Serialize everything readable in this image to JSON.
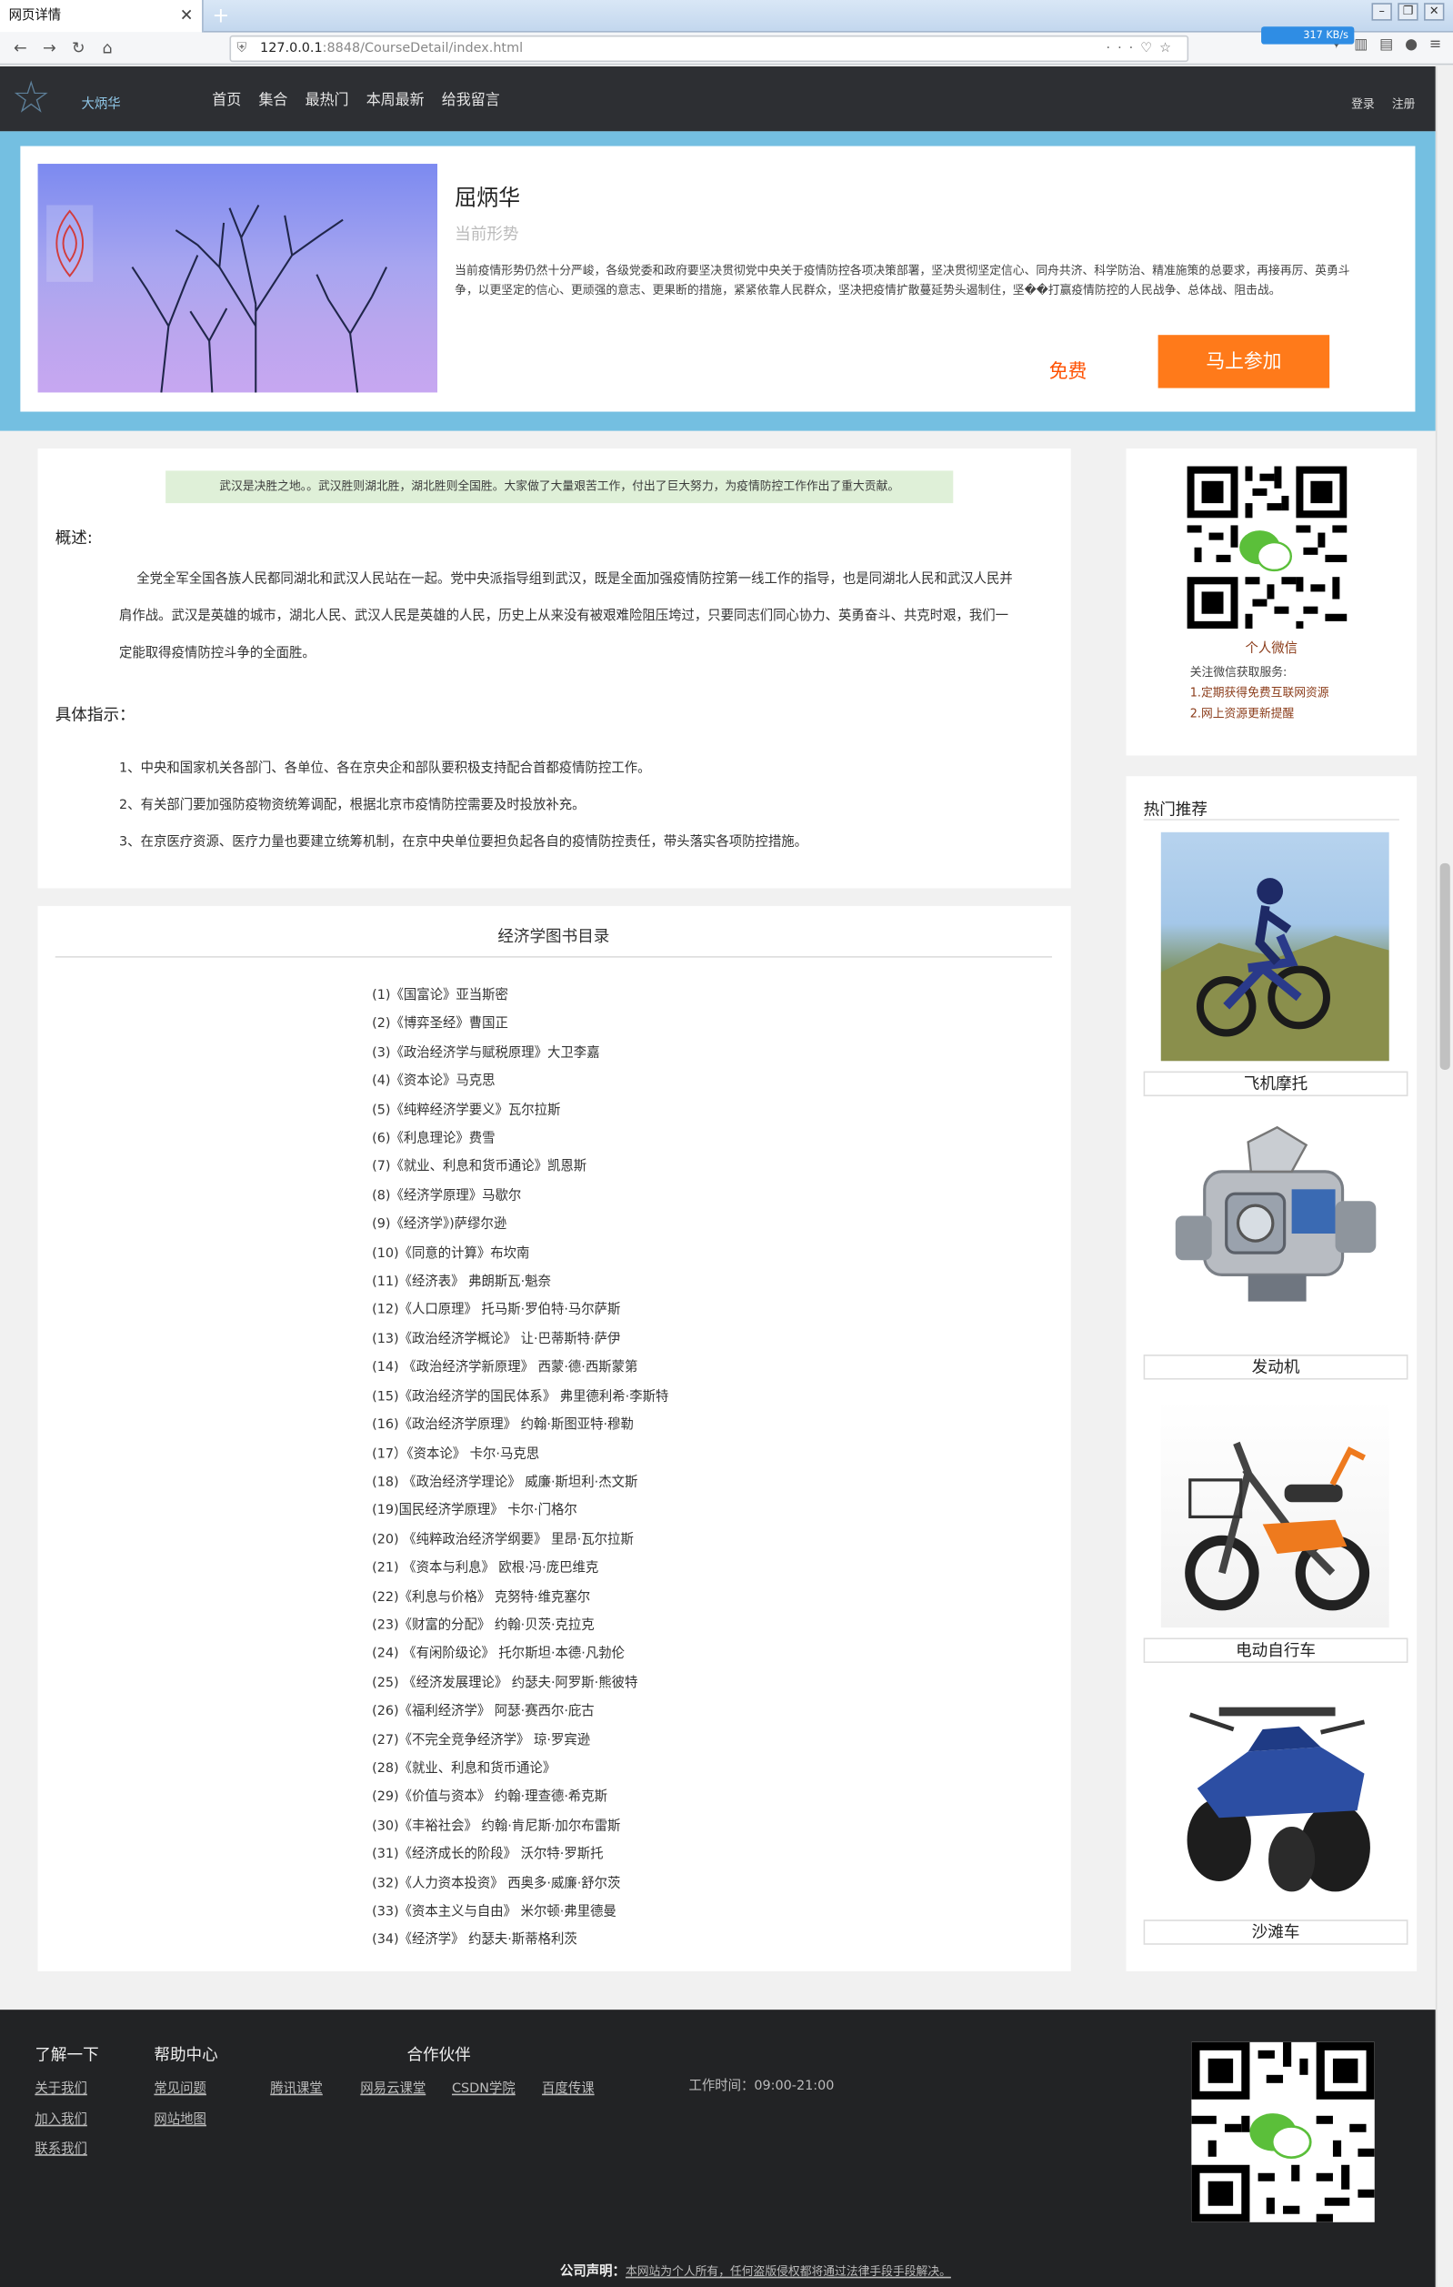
{
  "browser": {
    "tab_title": "网页详情",
    "url_host": "127.0.0.1",
    "url_rest": ":8848/CourseDetail/index.html",
    "speed": "317 KB/s"
  },
  "site": {
    "brand": "大炳华",
    "nav": [
      "首页",
      "集合",
      "最热门",
      "本周最新",
      "给我留言"
    ],
    "login": "登录",
    "register": "注册"
  },
  "course": {
    "title": "屈炳华",
    "subtitle": "当前形势",
    "description": "当前疫情形势仍然十分严峻，各级党委和政府要坚决贯彻党中央关于疫情防控各项决策部署，坚决贯彻坚定信心、同舟共济、科学防治、精准施策的总要求，再接再厉、英勇斗争，以更坚定的信心、更顽强的意志、更果断的措施，紧紧依靠人民群众，坚决把疫情扩散蔓延势头遏制住，坚��打赢疫情防控的人民战争、总体战、阻击战。",
    "price": "免费",
    "join_label": "马上参加"
  },
  "overview": {
    "notice": "武汉是决胜之地。。武汉胜则湖北胜，湖北胜则全国胜。大家做了大量艰苦工作，付出了巨大努力，为疫情防控工作作出了重大贡献。",
    "heading": "概述:",
    "paragraph": "全党全军全国各族人民都同湖北和武汉人民站在一起。党中央派指导组到武汉，既是全面加强疫情防控第一线工作的指导，也是同湖北人民和武汉人民并肩作战。武汉是英雄的城市，湖北人民、武汉人民是英雄的人民，历史上从来没有被艰难险阻压垮过，只要同志们同心协力、英勇奋斗、共克时艰，我们一定能取得疫情防控斗争的全面胜。",
    "directives_heading": "具体指示：",
    "directives": [
      "1、中央和国家机关各部门、各单位、各在京央企和部队要积极支持配合首都疫情防控工作。",
      "2、有关部门要加强防疫物资统筹调配，根据北京市疫情防控需要及时投放补充。",
      "3、在京医疗资源、医疗力量也要建立统筹机制，在京中央单位要担负起各自的疫情防控责任，带头落实各项防控措施。"
    ]
  },
  "booklist": {
    "title": "经济学图书目录",
    "books": [
      "(1)《国富论》亚当斯密",
      "(2)《博弈圣经》曹国正",
      "(3)《政治经济学与赋税原理》大卫李嘉",
      "(4)《资本论》马克思",
      "(5)《纯粹经济学要义》瓦尔拉斯",
      "(6)《利息理论》费雪",
      "(7)《就业、利息和货币通论》凯恩斯",
      "(8)《经济学原理》马歇尔",
      "(9)《经济学》)萨缪尔逊",
      "(10)《同意的计算》布坎南",
      "(11)《经济表》 弗朗斯瓦·魁奈",
      "(12)《人口原理》 托马斯·罗伯特·马尔萨斯",
      "(13)《政治经济学概论》 让·巴蒂斯特·萨伊",
      "(14) 《政治经济学新原理》 西蒙·德·西斯蒙第",
      "(15)《政治经济学的国民体系》 弗里德利希·李斯特",
      "(16)《政治经济学原理》 约翰·斯图亚特·穆勒",
      "(17）《资本论》 卡尔·马克思",
      "(18) 《政治经济学理论》 威廉·斯坦利·杰文斯",
      "(19)国民经济学原理》 卡尔·门格尔",
      "(20) 《纯粹政治经济学纲要》 里昂·瓦尔拉斯",
      "(21) 《资本与利息》 欧根·冯·庞巴维克",
      "(22)《利息与价格》 克努特·维克塞尔",
      "(23)《财富的分配》 约翰·贝茨·克拉克",
      "(24) 《有闲阶级论》 托尔斯坦·本德·凡勃伦",
      "(25) 《经济发展理论》 约瑟夫·阿罗斯·熊彼特",
      "(26)《福利经济学》 阿瑟·赛西尔·庇古",
      "(27)《不完全竞争经济学》 琼·罗宾逊",
      "(28)《就业、利息和货币通论》",
      "(29)《价值与资本》 约翰·理查德·希克斯",
      "(30)《丰裕社会》 约翰·肯尼斯·加尔布雷斯",
      "(31)《经济成长的阶段》 沃尔特·罗斯托",
      "(32)《人力资本投资》 西奥多·威廉·舒尔茨",
      "(33)《资本主义与自由》 米尔顿·弗里德曼",
      "(34)《经济学》 约瑟夫·斯蒂格利茨"
    ]
  },
  "wechat": {
    "caption": "个人微信",
    "info_title": "关注微信获取服务:",
    "items": [
      "1.定期获得免费互联网资源",
      "2.网上资源更新提醒"
    ]
  },
  "hot": {
    "title": "热门推荐",
    "items": [
      {
        "label": "飞机摩托",
        "icon": "motocross-image"
      },
      {
        "label": "发动机",
        "icon": "engine-image"
      },
      {
        "label": "电动自行车",
        "icon": "ebike-image"
      },
      {
        "label": "沙滩车",
        "icon": "atv-image"
      }
    ]
  },
  "footer": {
    "about_title": "了解一下",
    "about_links": [
      "关于我们",
      "加入我们",
      "联系我们"
    ],
    "help_title": "帮助中心",
    "help_links": [
      "常见问题",
      "网站地图"
    ],
    "tencent": "腾讯课堂",
    "partner_title": "合作伙伴",
    "partners": [
      "网易云课堂",
      "CSDN学院",
      "百度传课"
    ],
    "worktime": "工作时间：09:00-21:00",
    "copyright_bold": "公司声明：",
    "copyright_text": "本网站为个人所有，任何盗版侵权都将通过法律手段手段解决。"
  },
  "colors": {
    "banner_bg": "#74bfe1",
    "header_bg": "#2d2f33",
    "accent_orange": "#ff7a1a",
    "price_red": "#ff5000",
    "footer_bg": "#222325"
  }
}
